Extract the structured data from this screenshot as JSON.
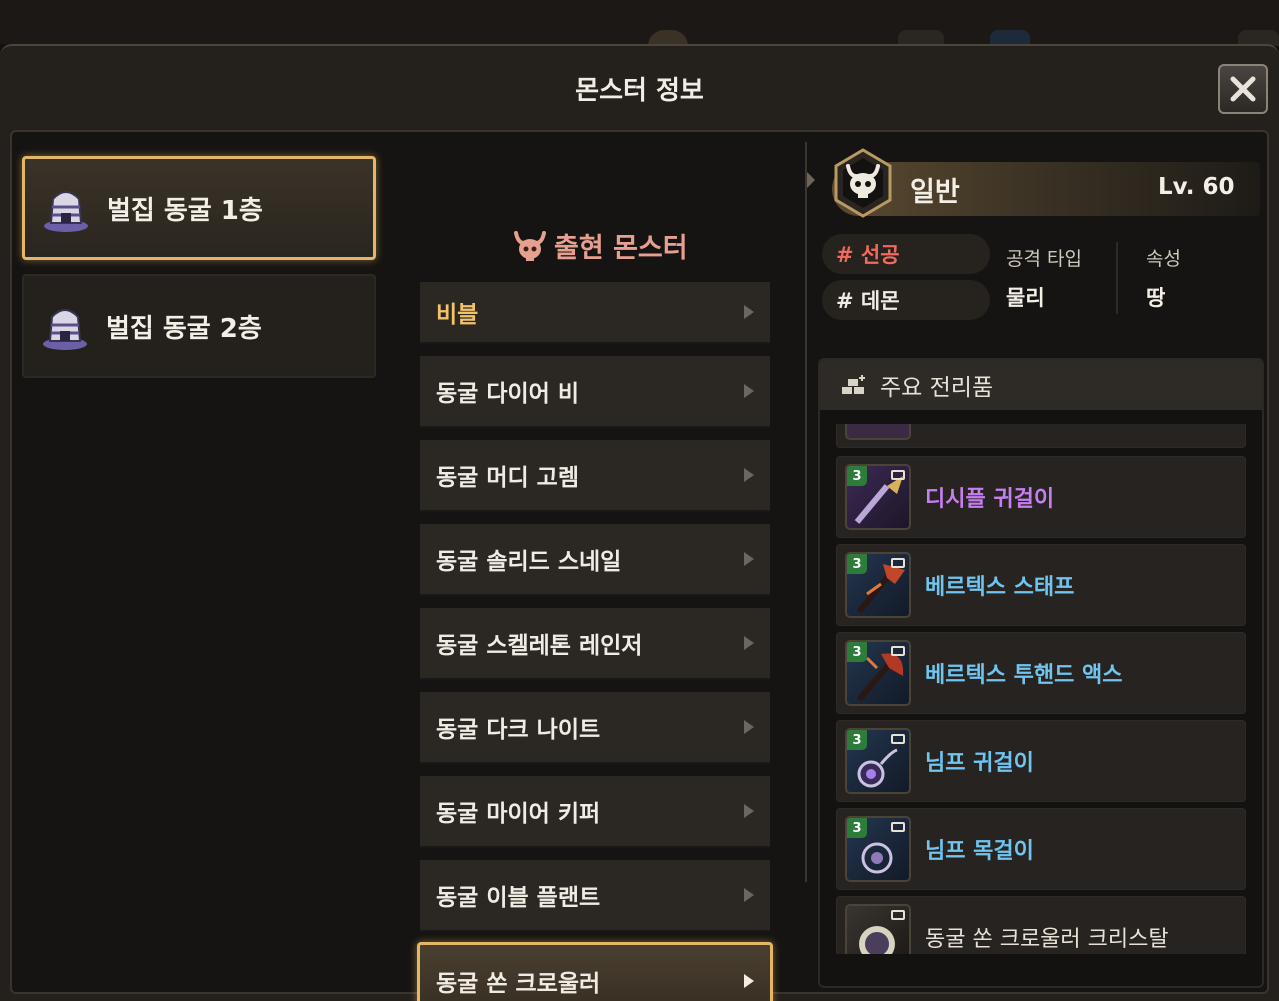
{
  "window": {
    "title": "몬스터 정보"
  },
  "floors": [
    {
      "label": "벌집 동굴 1층",
      "active": true
    },
    {
      "label": "벌집 동굴 2층",
      "active": false
    }
  ],
  "monsters": {
    "header": "출현 몬스터",
    "items": [
      {
        "label": "비블"
      },
      {
        "label": "동굴 다이어 비"
      },
      {
        "label": "동굴 머디 고렘"
      },
      {
        "label": "동굴 솔리드 스네일"
      },
      {
        "label": "동굴 스켈레톤 레인저"
      },
      {
        "label": "동굴 다크 나이트"
      },
      {
        "label": "동굴 마이어 키퍼"
      },
      {
        "label": "동굴 이블 플랜트"
      },
      {
        "label": "동굴 쏜 크로울러"
      }
    ],
    "selected_index": 8
  },
  "detail": {
    "grade": "일반",
    "level": "Lv. 60",
    "tags": [
      "# 선공",
      "# 데몬"
    ],
    "attack_type_label": "공격 타입",
    "attack_type_value": "물리",
    "element_label": "속성",
    "element_value": "땅",
    "loot_header": "주요 전리품",
    "loot": [
      {
        "name": "디시플 귀걸이",
        "tier": "3",
        "color": "#c77ff0",
        "icon": "earring-icon"
      },
      {
        "name": "베르텍스 스태프",
        "tier": "3",
        "color": "#6fc4f0",
        "icon": "staff-icon"
      },
      {
        "name": "베르텍스 투핸드 액스",
        "tier": "3",
        "color": "#6fc4f0",
        "icon": "axe-icon"
      },
      {
        "name": "님프 귀걸이",
        "tier": "3",
        "color": "#6fc4f0",
        "icon": "earring-icon"
      },
      {
        "name": "님프 목걸이",
        "tier": "3",
        "color": "#6fc4f0",
        "icon": "necklace-icon"
      },
      {
        "name": "동굴 쏜 크로울러 크리스탈",
        "tier": "",
        "color": "#e8e2d6",
        "icon": "crystal-icon"
      }
    ]
  },
  "colors": {
    "accent_gold": "#e3b765",
    "hostile_red": "#f06a5e",
    "rare_blue": "#6fc4f0",
    "epic_purple": "#c77ff0",
    "first_monster_yellow": "#f2c46a"
  }
}
